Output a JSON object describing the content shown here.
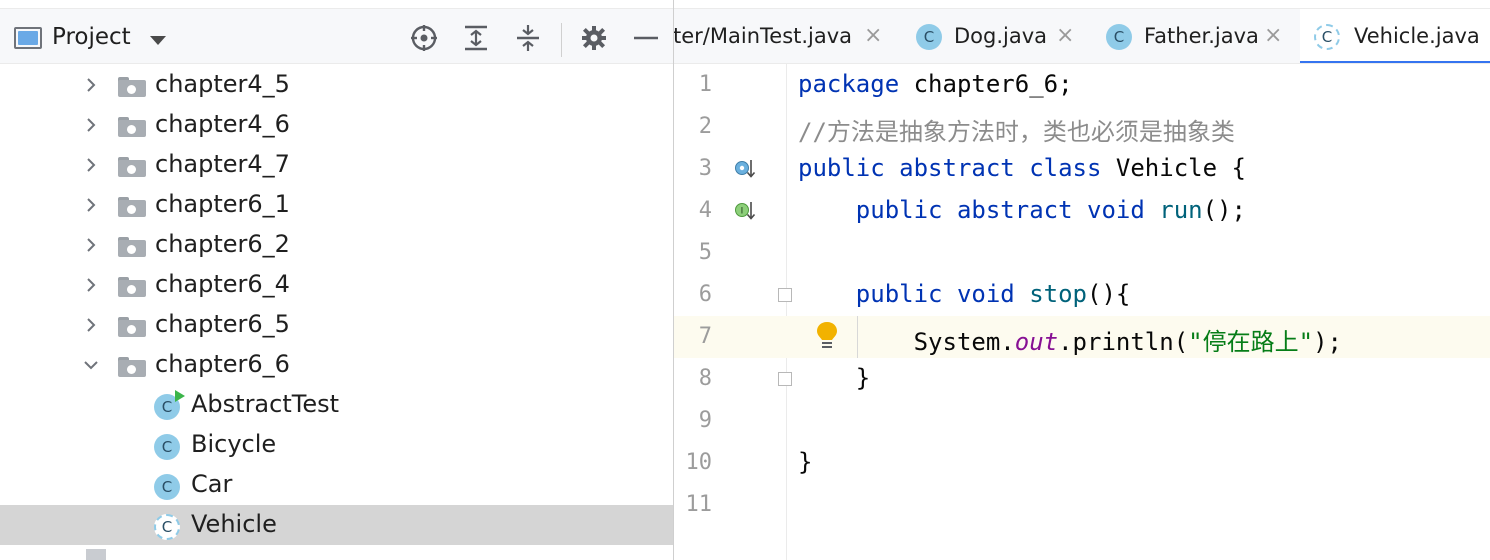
{
  "project_panel": {
    "title": "Project",
    "tree": [
      {
        "label": "chapter4_5",
        "kind": "package",
        "expanded": false
      },
      {
        "label": "chapter4_6",
        "kind": "package",
        "expanded": false
      },
      {
        "label": "chapter4_7",
        "kind": "package",
        "expanded": false
      },
      {
        "label": "chapter6_1",
        "kind": "package",
        "expanded": false
      },
      {
        "label": "chapter6_2",
        "kind": "package",
        "expanded": false
      },
      {
        "label": "chapter6_4",
        "kind": "package",
        "expanded": false
      },
      {
        "label": "chapter6_5",
        "kind": "package",
        "expanded": false
      },
      {
        "label": "chapter6_6",
        "kind": "package",
        "expanded": true
      },
      {
        "label": "AbstractTest",
        "kind": "class-runnable"
      },
      {
        "label": "Bicycle",
        "kind": "class"
      },
      {
        "label": "Car",
        "kind": "class"
      },
      {
        "label": "Vehicle",
        "kind": "abstract-class",
        "selected": true
      }
    ],
    "icons": [
      "locate-icon",
      "expand-all-icon",
      "collapse-all-icon",
      "gear-icon",
      "minimize-icon"
    ]
  },
  "editor": {
    "tabs": [
      {
        "label": "fter/MainTest.java",
        "active": false
      },
      {
        "label": "Dog.java",
        "active": false,
        "icon": "C"
      },
      {
        "label": "Father.java",
        "active": false,
        "icon": "C"
      },
      {
        "label": "Vehicle.java",
        "active": true,
        "icon": "C"
      }
    ],
    "close_glyph": "×",
    "class_glyph": "C",
    "line_numbers": [
      "1",
      "2",
      "3",
      "4",
      "5",
      "6",
      "7",
      "8",
      "9",
      "10",
      "11"
    ],
    "code": {
      "l1_kw": "package",
      "l1_rest": " chapter6_6;",
      "l2_comment": "//方法是抽象方法时，类也必须是抽象类",
      "l3_kw1": "public",
      "l3_kw2": "abstract",
      "l3_kw3": "class",
      "l3_rest": " Vehicle {",
      "l4_indent": "    ",
      "l4_kw1": "public",
      "l4_kw2": "abstract",
      "l4_kw3": "void",
      "l4_fn": "run",
      "l4_rest": "();",
      "l6_indent": "    ",
      "l6_kw1": "public",
      "l6_kw2": "void",
      "l6_fn": "stop",
      "l6_rest": "(){",
      "l7_indent": "        ",
      "l7_obj": "System.",
      "l7_field": "out",
      "l7_call": ".println(",
      "l7_str": "\"停在路上\"",
      "l7_end": ");",
      "l8": "    }",
      "l10": "}"
    },
    "colors": {
      "keyword": "#0033b3",
      "comment": "#8c8c8c",
      "string": "#067d17",
      "field": "#871094",
      "method": "#00627a",
      "active_tab_underline": "#3574f0"
    }
  }
}
